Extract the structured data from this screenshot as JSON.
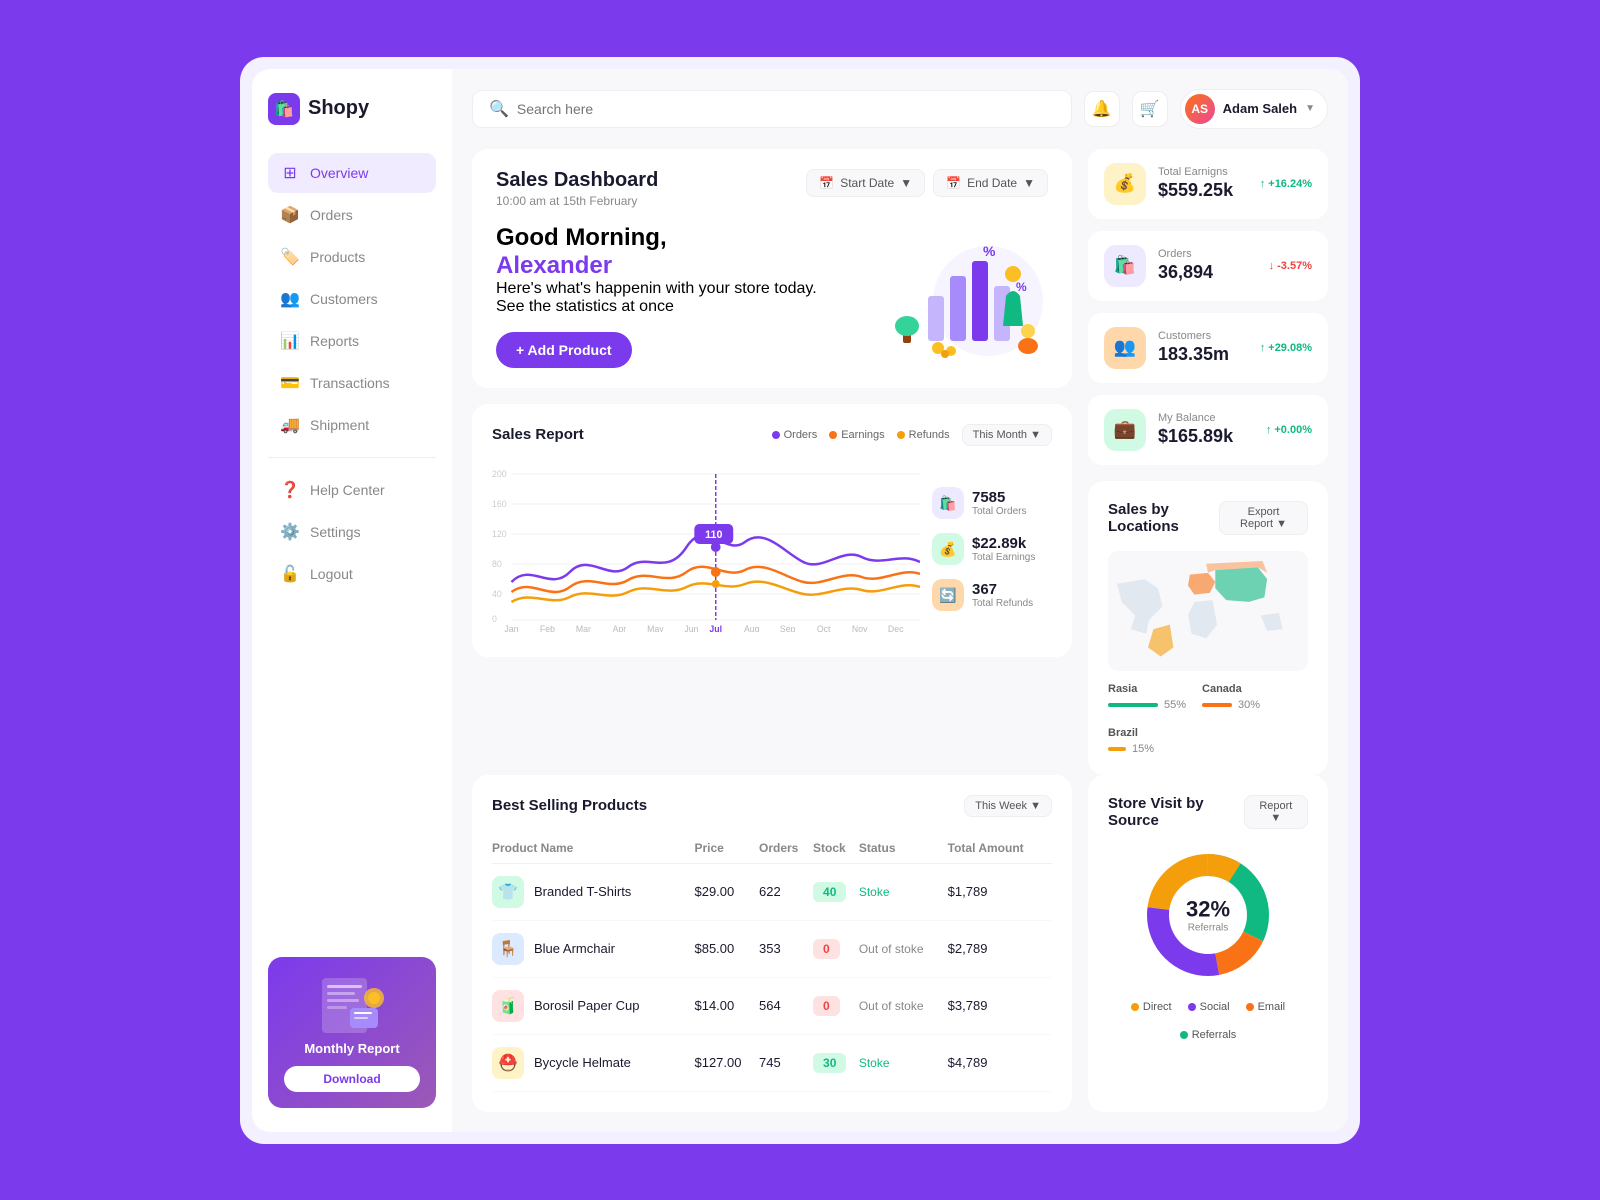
{
  "app": {
    "name": "Shopy",
    "logo_icon": "🛍️"
  },
  "sidebar": {
    "nav_items": [
      {
        "id": "overview",
        "label": "Overview",
        "icon": "⊞",
        "active": true
      },
      {
        "id": "orders",
        "label": "Orders",
        "icon": "📦"
      },
      {
        "id": "products",
        "label": "Products",
        "icon": "🏷️"
      },
      {
        "id": "customers",
        "label": "Customers",
        "icon": "👥"
      },
      {
        "id": "reports",
        "label": "Reports",
        "icon": "📊"
      },
      {
        "id": "transactions",
        "label": "Transactions",
        "icon": "💳"
      },
      {
        "id": "shipment",
        "label": "Shipment",
        "icon": "🚚"
      }
    ],
    "bottom_nav": [
      {
        "id": "help",
        "label": "Help Center",
        "icon": "❓"
      },
      {
        "id": "settings",
        "label": "Settings",
        "icon": "⚙️"
      },
      {
        "id": "logout",
        "label": "Logout",
        "icon": "🔓"
      }
    ],
    "monthly_report": {
      "title": "Monthly Report",
      "download_label": "Download"
    }
  },
  "topbar": {
    "search_placeholder": "Search here",
    "user_name": "Adam Saleh",
    "user_initials": "AS"
  },
  "sales_dashboard": {
    "title": "Sales Dashboard",
    "date": "10:00 am at 15th February",
    "start_date_label": "Start Date",
    "end_date_label": "End Date",
    "greeting": "Good Morning,",
    "name": "Alexander",
    "subtitle_line1": "Here's what's happenin with your store today.",
    "subtitle_line2": "See the statistics at once",
    "add_product_label": "+ Add Product"
  },
  "stats": [
    {
      "id": "earnings",
      "label": "Total Earnigns",
      "value": "$559.25k",
      "change": "+16.24%",
      "up": true,
      "icon": "💰",
      "color": "yellow"
    },
    {
      "id": "orders",
      "label": "Orders",
      "value": "36,894",
      "change": "-3.57%",
      "up": false,
      "icon": "🛍️",
      "color": "purple"
    },
    {
      "id": "customers",
      "label": "Customers",
      "value": "183.35m",
      "change": "+29.08%",
      "up": true,
      "icon": "👥",
      "color": "orange"
    },
    {
      "id": "balance",
      "label": "My Balance",
      "value": "$165.89k",
      "change": "+0.00%",
      "up": true,
      "icon": "💼",
      "color": "teal"
    }
  ],
  "sales_report": {
    "title": "Sales Report",
    "filter": "This Month",
    "legend": [
      {
        "label": "Orders",
        "color": "#7c3aed"
      },
      {
        "label": "Earnings",
        "color": "#f97316"
      },
      {
        "label": "Refunds",
        "color": "#f59e0b"
      }
    ],
    "tooltip_value": "110",
    "total_orders": "7585",
    "total_orders_label": "Total Orders",
    "total_earnings": "$22.89k",
    "total_earnings_label": "Total Earnings",
    "total_refunds": "367",
    "total_refunds_label": "Total Refunds",
    "months": [
      "Jan",
      "Feb",
      "Mar",
      "Apr",
      "May",
      "Jun",
      "Jul",
      "Aug",
      "Sep",
      "Oct",
      "Nov",
      "Dec"
    ]
  },
  "sales_locations": {
    "title": "Sales by Locations",
    "export_label": "Export Report",
    "locations": [
      {
        "name": "Rasia",
        "pct": 55,
        "color": "#10b981"
      },
      {
        "name": "Canada",
        "pct": 30,
        "color": "#f97316"
      },
      {
        "name": "Brazil",
        "pct": 15,
        "color": "#f59e0b"
      }
    ]
  },
  "best_selling": {
    "title": "Best Selling Products",
    "filter": "This Week",
    "columns": [
      "Product Name",
      "Price",
      "Orders",
      "Stock",
      "Status",
      "Total Amount"
    ],
    "products": [
      {
        "name": "Branded T-Shirts",
        "icon": "👕",
        "icon_bg": "#d1fae5",
        "price": "$29.00",
        "orders": "622",
        "stock": 40,
        "stock_type": "green",
        "status": "Stoke",
        "total": "$1,789"
      },
      {
        "name": "Blue Armchair",
        "icon": "🪑",
        "icon_bg": "#dbeafe",
        "price": "$85.00",
        "orders": "353",
        "stock": 0,
        "stock_type": "red",
        "status": "Out of stoke",
        "total": "$2,789"
      },
      {
        "name": "Borosil Paper Cup",
        "icon": "🧃",
        "icon_bg": "#fee2e2",
        "price": "$14.00",
        "orders": "564",
        "stock": 0,
        "stock_type": "red",
        "status": "Out of stoke",
        "total": "$3,789"
      },
      {
        "name": "Bycycle Helmate",
        "icon": "⛑️",
        "icon_bg": "#fef3c7",
        "price": "$127.00",
        "orders": "745",
        "stock": 30,
        "stock_type": "green",
        "status": "Stoke",
        "total": "$4,789"
      }
    ]
  },
  "store_visit": {
    "title": "Store Visit by Source",
    "filter": "Report",
    "center_pct": "32%",
    "center_label": "Referrals",
    "legend": [
      {
        "label": "Direct",
        "color": "#f59e0b"
      },
      {
        "label": "Social",
        "color": "#7c3aed"
      },
      {
        "label": "Email",
        "color": "#f97316"
      },
      {
        "label": "Referrals",
        "color": "#10b981"
      }
    ]
  }
}
